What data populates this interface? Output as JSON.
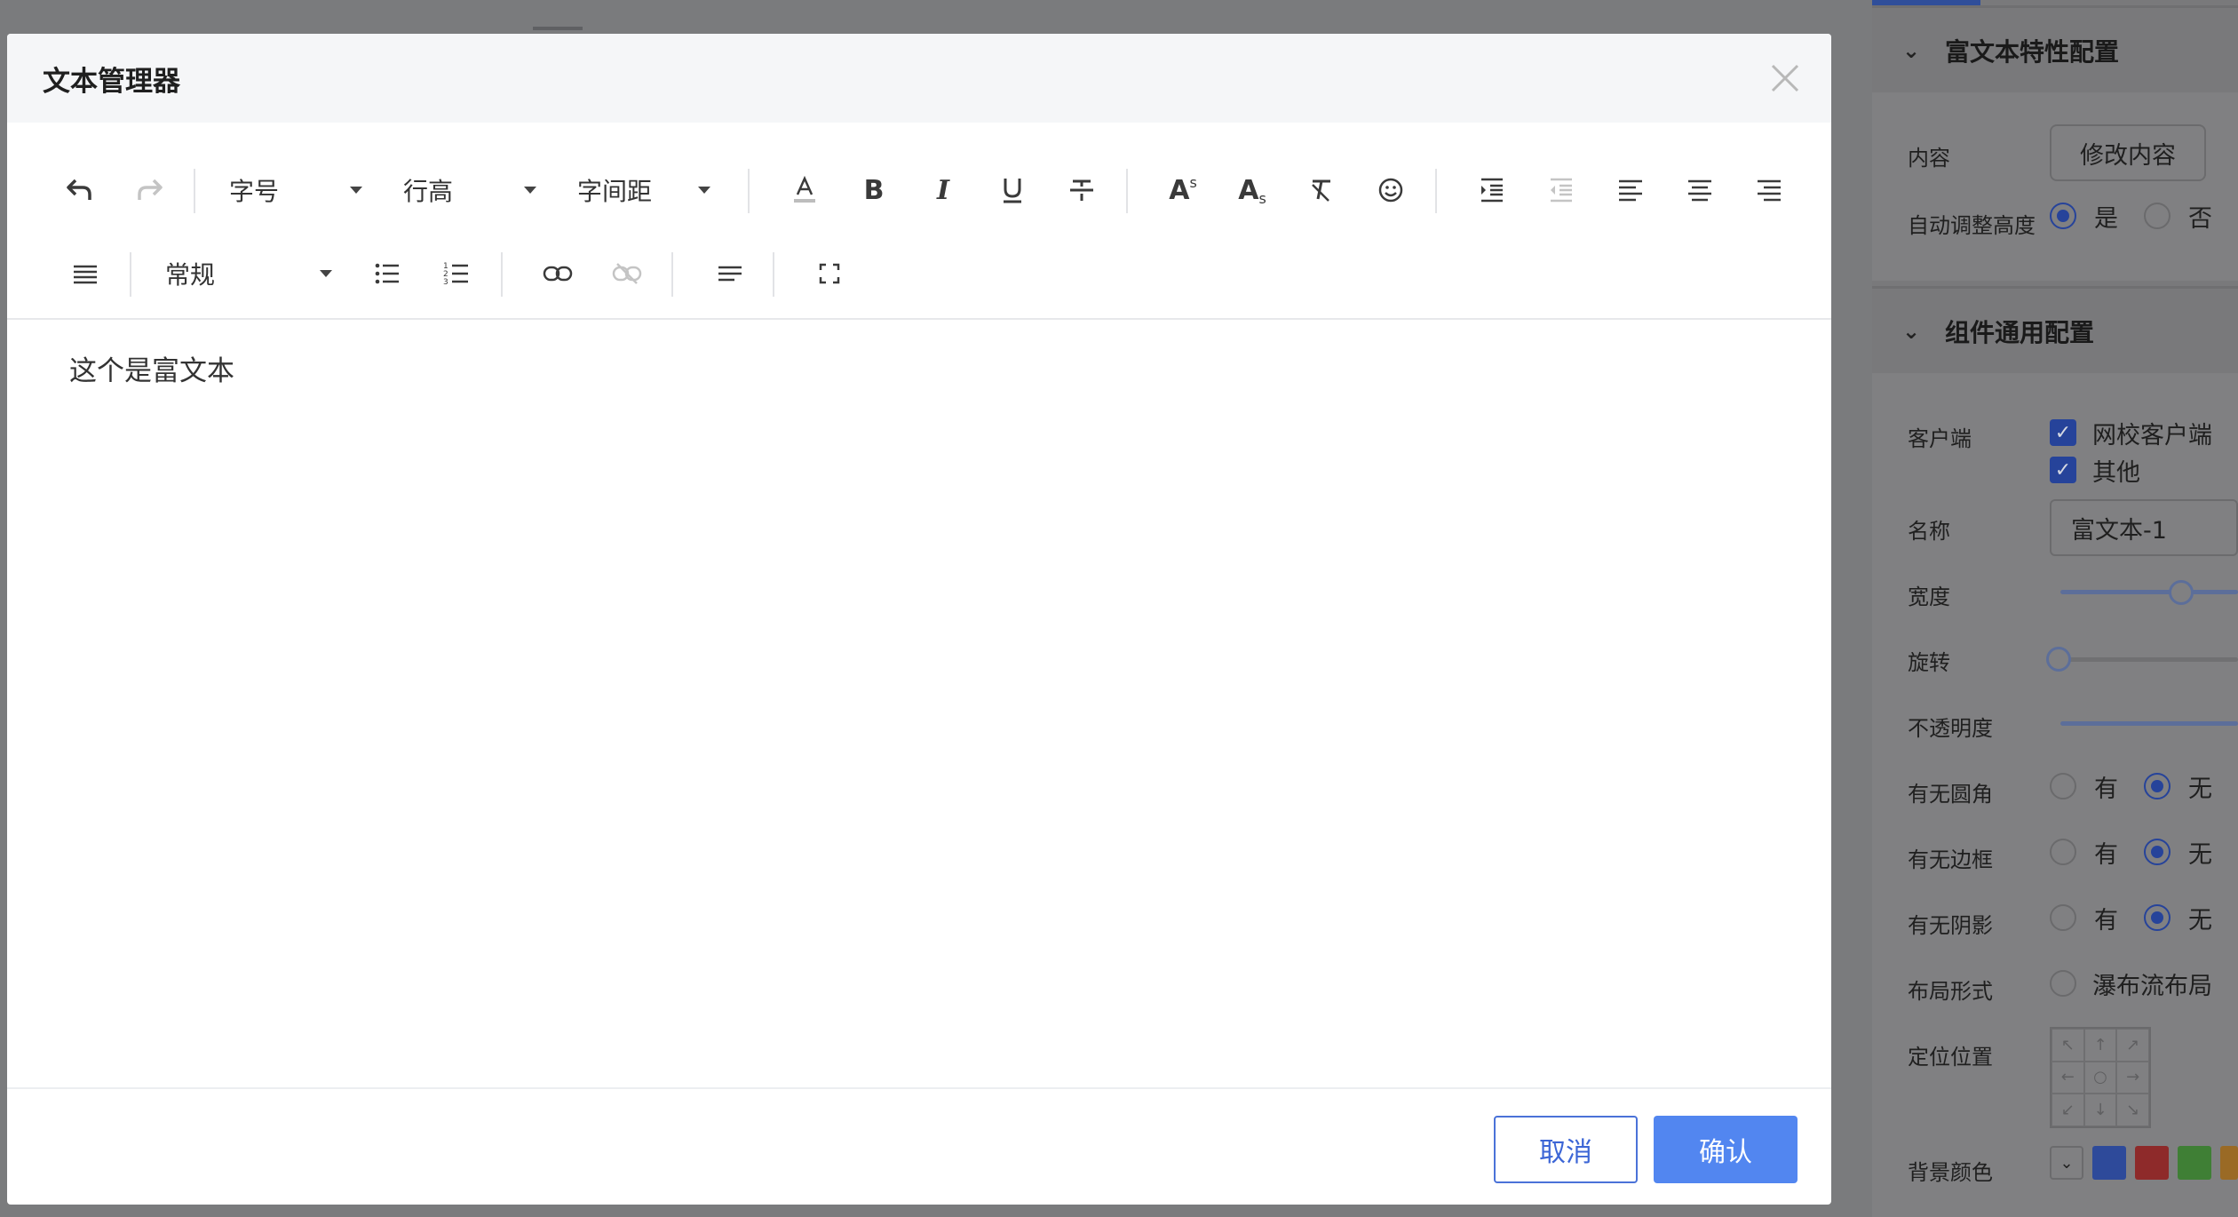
{
  "modal": {
    "title": "文本管理器",
    "editor_content": "这个是富文本",
    "cancel_label": "取消",
    "confirm_label": "确认"
  },
  "toolbar": {
    "font_size_label": "字号",
    "line_height_label": "行高",
    "letter_spacing_label": "字间距",
    "paragraph_style_label": "常规"
  },
  "right_panel": {
    "rich_text_section": {
      "title": "富文本特性配置",
      "content_label": "内容",
      "edit_content_button": "修改内容",
      "auto_height_label": "自动调整高度",
      "auto_height_yes": "是",
      "auto_height_no": "否",
      "auto_height_value": "是"
    },
    "common_section": {
      "title": "组件通用配置",
      "client_label": "客户端",
      "client_options": [
        "网校客户端",
        "其他"
      ],
      "name_label": "名称",
      "name_value": "富文本-1",
      "width_label": "宽度",
      "rotate_label": "旋转",
      "opacity_label": "不透明度",
      "rounded_label": "有无圆角",
      "border_label": "有无边框",
      "shadow_label": "有无阴影",
      "option_yes": "有",
      "option_no": "无",
      "layout_label": "布局形式",
      "layout_option": "瀑布流布局",
      "position_label": "定位位置",
      "bg_color_label": "背景颜色",
      "bg_colors": [
        "#2e4a9a",
        "#8e2a2a",
        "#3f7f35",
        "#9a6a25"
      ]
    }
  },
  "accent_color": "#5286f0"
}
